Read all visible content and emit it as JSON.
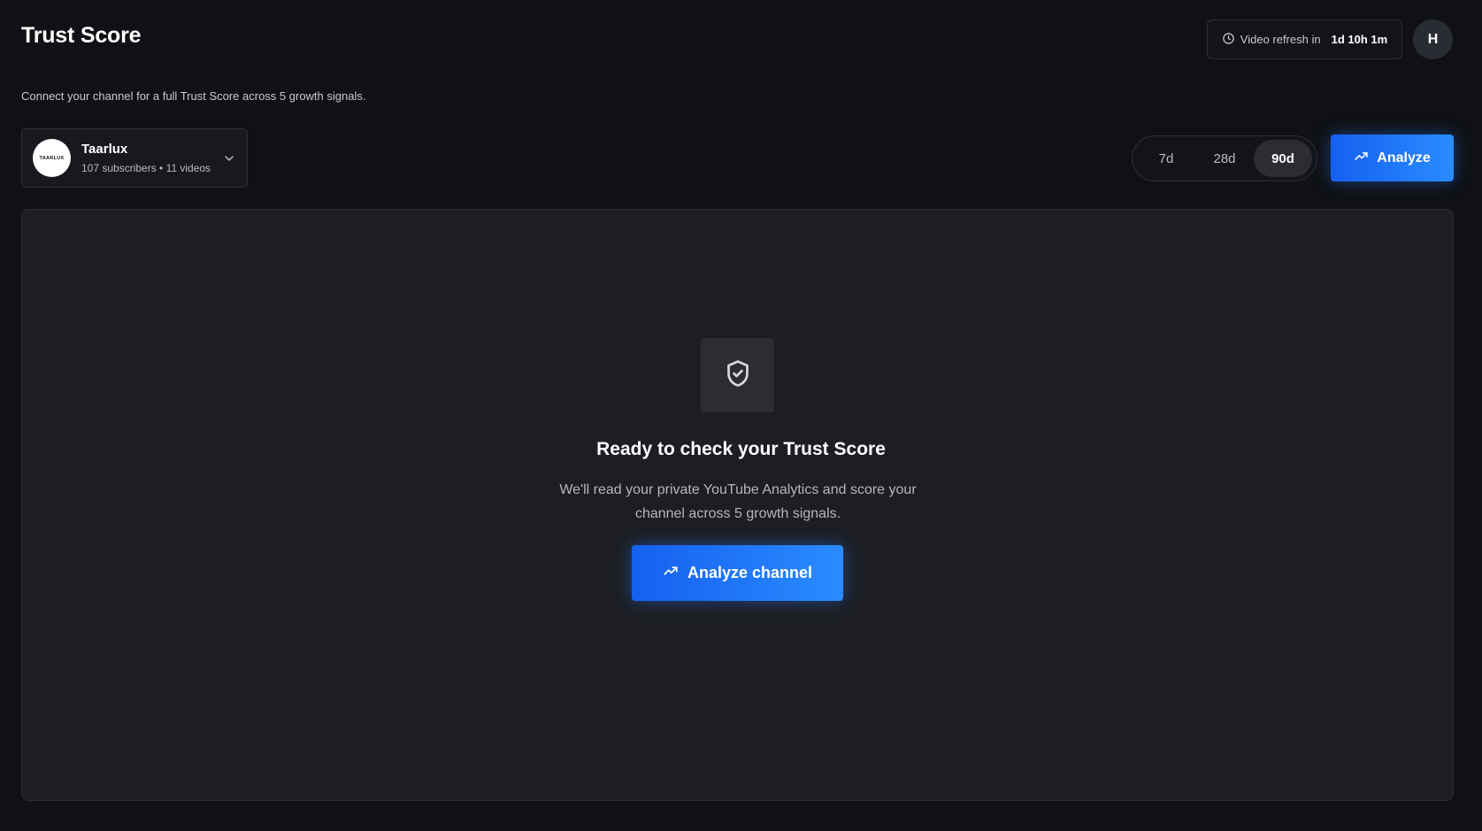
{
  "header": {
    "title": "Trust Score",
    "refresh_label": "Video refresh in",
    "refresh_time": "1d 10h 1m",
    "avatar_initial": "H"
  },
  "subtitle": "Connect your channel for a full Trust Score across 5 growth signals.",
  "channel": {
    "logo_text": "TAARLUX",
    "name": "Taarlux",
    "meta": "107 subscribers • 11 videos"
  },
  "range": {
    "options": [
      "7d",
      "28d",
      "90d"
    ],
    "selected": "90d"
  },
  "analyze_button_label": "Analyze",
  "empty_state": {
    "icon": "shield-check-icon",
    "title": "Ready to check your Trust Score",
    "description": "We'll read your private YouTube Analytics and score your channel across 5 growth signals.",
    "button_label": "Analyze channel"
  },
  "colors": {
    "background": "#0f1115",
    "card": "#1c1e23",
    "accent": "#1f78ff"
  }
}
